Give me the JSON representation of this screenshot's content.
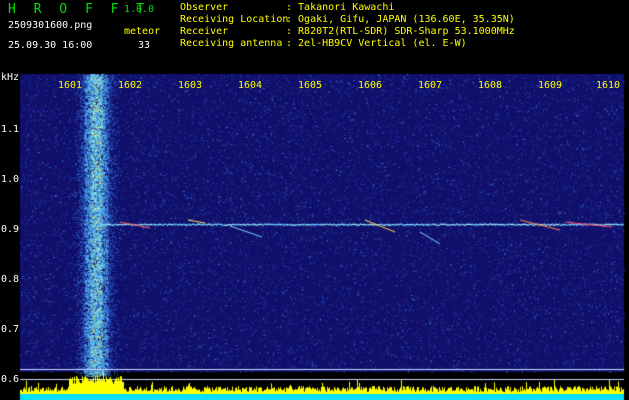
{
  "header": {
    "app_title": "H R O F F T",
    "app_version": "1.0.0",
    "file_name": "2509301600.png",
    "meteor_label": "meteor",
    "timestamp": "25.09.30 16:00",
    "meteor_count": "33"
  },
  "info": [
    {
      "label": "Observer",
      "value": ": Takanori Kawachi"
    },
    {
      "label": "Receiving Location",
      "value": ": Ogaki, Gifu, JAPAN (136.60E, 35.35N)"
    },
    {
      "label": "Receiver",
      "value": ": R820T2(RTL-SDR) SDR-Sharp 53.1000MHz"
    },
    {
      "label": "Receiving antenna",
      "value": ": 2el-HB9CV Vertical (el. E-W)"
    }
  ],
  "axis": {
    "y_unit": "kHz",
    "x_ticks": [
      "1601",
      "1602",
      "1603",
      "1604",
      "1605",
      "1606",
      "1607",
      "1608",
      "1609",
      "1610"
    ],
    "y_ticks": [
      "1.1",
      "1.0",
      "0.9",
      "0.8",
      "0.7",
      "0.6"
    ]
  },
  "colors": {
    "title": "#00e000",
    "header_text": "#ffff00",
    "x_axis_labels": "#ffff00",
    "y_axis_labels": "#ffffff",
    "spectrogram_background": "#10106a",
    "signal_level_bar": "#ffff00",
    "baseline": "#00e0ff"
  }
}
